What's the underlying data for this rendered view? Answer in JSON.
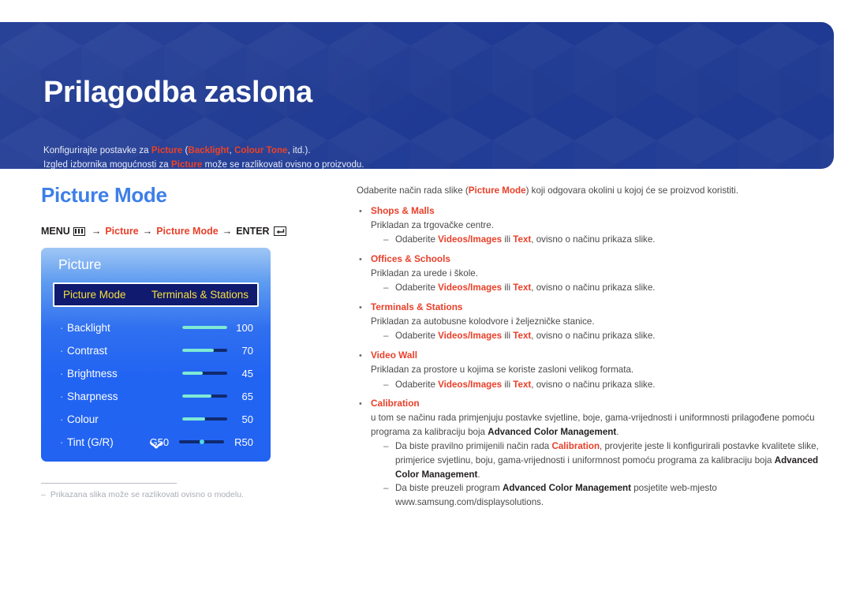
{
  "banner": {
    "title": "Prilagodba zaslona",
    "line1": {
      "a": "Konfigurirajte postavke za ",
      "hl1": "Picture",
      "b": " (",
      "hl2": "Backlight",
      "c": ", ",
      "hl3": "Colour Tone",
      "d": ", itd.)."
    },
    "line2": {
      "a": "Izgled izbornika mogućnosti za ",
      "hl1": "Picture",
      "b": " može se razlikovati ovisno o proizvodu."
    }
  },
  "section": {
    "title": "Picture Mode",
    "breadcrumb": {
      "menu": "MENU",
      "arrow": "→",
      "step1": "Picture",
      "step2": "Picture Mode",
      "enter": "ENTER"
    }
  },
  "osd": {
    "title": "Picture",
    "highlight": {
      "label": "Picture Mode",
      "value": "Terminals & Stations"
    },
    "items": [
      {
        "label": "Backlight",
        "value": "100",
        "fill": 100
      },
      {
        "label": "Contrast",
        "value": "70",
        "fill": 70
      },
      {
        "label": "Brightness",
        "value": "45",
        "fill": 45
      },
      {
        "label": "Sharpness",
        "value": "65",
        "fill": 65
      },
      {
        "label": "Colour",
        "value": "50",
        "fill": 50
      }
    ],
    "tint": {
      "label": "Tint (G/R)",
      "left": "G50",
      "right": "R50"
    },
    "more_icon": "chevron-down-icon"
  },
  "footnote": {
    "dash": "‒",
    "text": "Prikazana slika može se razlikovati ovisno o modelu."
  },
  "content": {
    "intro": {
      "a": "Odaberite način rada slike (",
      "hl": "Picture Mode",
      "b": ") koji odgovara okolini u kojoj će se proizvod koristiti."
    },
    "choose_line": {
      "a": "Odaberite ",
      "hl1": "Videos/Images",
      "b": " ili ",
      "hl2": "Text",
      "c": ", ovisno o načinu prikaza slike."
    },
    "groups": [
      {
        "name": "Shops & Malls",
        "desc": "Prikladan za trgovačke centre."
      },
      {
        "name": "Offices & Schools",
        "desc": "Prikladan za urede i škole."
      },
      {
        "name": "Terminals & Stations",
        "desc": "Prikladan za autobusne kolodvore i željezničke stanice."
      },
      {
        "name": "Video Wall",
        "desc": "Prikladan za prostore u kojima se koriste zasloni velikog formata."
      }
    ],
    "calibration": {
      "name": "Calibration",
      "desc_a": "u tom se načinu rada primjenjuju postavke svjetline, boje, gama-vrijednosti i uniformnosti prilagođene pomoću programa za kalibraciju boja ",
      "desc_b": "Advanced Color Management",
      "desc_c": ".",
      "sub1_a": "Da biste pravilno primijenili način rada ",
      "sub1_hl": "Calibration",
      "sub1_b": ", provjerite jeste li konfigurirali postavke kvalitete slike, primjerice svjetlinu, boju, gama-vrijednosti i uniformnost pomoću programa za kalibraciju boja ",
      "sub1_bold": "Advanced Color Management",
      "sub1_c": ".",
      "sub2_a": "Da biste preuzeli program ",
      "sub2_bold": "Advanced Color Management",
      "sub2_b": " posjetite web-mjesto www.samsung.com/displaysolutions."
    }
  }
}
